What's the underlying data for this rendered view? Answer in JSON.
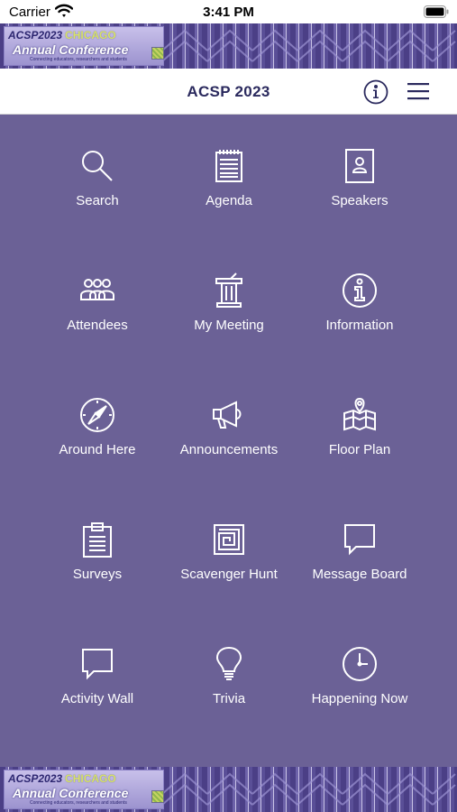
{
  "status_bar": {
    "carrier": "Carrier",
    "time": "3:41 PM"
  },
  "banner": {
    "line1_year": "ACSP2023",
    "line1_city": "CHICAGO",
    "line2": "Annual Conference",
    "line3": "Connecting educators, researchers and students"
  },
  "nav": {
    "title": "ACSP 2023",
    "info_icon": "info-icon",
    "menu_icon": "hamburger-menu-icon"
  },
  "tiles": [
    {
      "label": "Search",
      "icon": "search-icon"
    },
    {
      "label": "Agenda",
      "icon": "agenda-icon"
    },
    {
      "label": "Speakers",
      "icon": "speaker-badge-icon"
    },
    {
      "label": "Attendees",
      "icon": "attendees-icon"
    },
    {
      "label": "My Meeting",
      "icon": "podium-icon"
    },
    {
      "label": "Information",
      "icon": "info-icon"
    },
    {
      "label": "Around Here",
      "icon": "compass-icon"
    },
    {
      "label": "Announcements",
      "icon": "megaphone-icon"
    },
    {
      "label": "Floor Plan",
      "icon": "floor-plan-icon"
    },
    {
      "label": "Surveys",
      "icon": "clipboard-icon"
    },
    {
      "label": "Scavenger Hunt",
      "icon": "maze-icon"
    },
    {
      "label": "Message Board",
      "icon": "speech-bubble-icon"
    },
    {
      "label": "Activity Wall",
      "icon": "speech-bubble-icon"
    },
    {
      "label": "Trivia",
      "icon": "lightbulb-icon"
    },
    {
      "label": "Happening Now",
      "icon": "clock-icon"
    }
  ],
  "colors": {
    "grid_background": "#6b6196",
    "nav_title": "#2b2a5e",
    "banner_purple": "#4b3f86"
  }
}
